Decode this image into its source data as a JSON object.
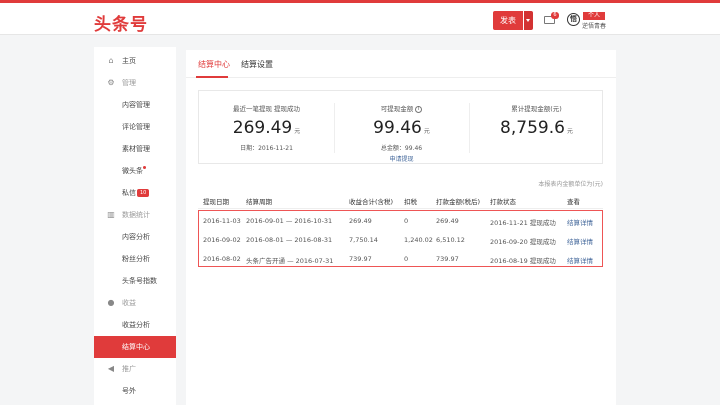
{
  "header": {
    "logo": "头条号",
    "publish_label": "发表",
    "mail_badge": "6",
    "avatar_text": "悟",
    "user_tag": "个人",
    "user_name": "逆悟青春"
  },
  "sidebar": {
    "items": [
      {
        "label": "主页",
        "icon": "home-icon",
        "type": "item"
      },
      {
        "label": "管理",
        "icon": "gear-icon",
        "type": "group"
      },
      {
        "label": "内容管理",
        "type": "sub"
      },
      {
        "label": "评论管理",
        "type": "sub"
      },
      {
        "label": "素材管理",
        "type": "sub"
      },
      {
        "label": "微头条",
        "type": "sub"
      },
      {
        "label": "私信",
        "type": "sub",
        "badge": "10"
      },
      {
        "label": "数据统计",
        "icon": "bar-chart-icon",
        "type": "group"
      },
      {
        "label": "内容分析",
        "type": "sub"
      },
      {
        "label": "粉丝分析",
        "type": "sub"
      },
      {
        "label": "头条号指数",
        "type": "sub"
      },
      {
        "label": "收益",
        "icon": "coin-icon",
        "type": "group"
      },
      {
        "label": "收益分析",
        "type": "sub"
      },
      {
        "label": "结算中心",
        "type": "sub",
        "active": true
      },
      {
        "label": "推广",
        "icon": "megaphone-icon",
        "type": "group"
      },
      {
        "label": "号外",
        "type": "sub"
      }
    ]
  },
  "tabs": [
    {
      "label": "结算中心",
      "active": true
    },
    {
      "label": "结算设置",
      "active": false
    }
  ],
  "summary": {
    "last": {
      "label": "最近一笔提现 提现成功",
      "amount": "269.49",
      "unit": "元",
      "date": "日期：2016-11-21"
    },
    "available": {
      "label": "可提现金额",
      "amount": "99.46",
      "unit": "元",
      "total": "总金额：99.46",
      "action": "申请提现"
    },
    "cumulative": {
      "label": "累计提现金额(元)",
      "amount": "8,759.6",
      "unit": "元"
    }
  },
  "note": "本报表内金额单位为(元)",
  "table": {
    "headers": [
      "提现日期",
      "结算周期",
      "收益合计(含税)",
      "扣税",
      "打款金额(税后)",
      "打款状态",
      "查看"
    ],
    "rows": [
      [
        "2016-11-03",
        "2016-09-01 — 2016-10-31",
        "269.49",
        "0",
        "269.49",
        "2016-11-21 提现成功",
        "结算详情"
      ],
      [
        "2016-09-02",
        "2016-08-01 — 2016-08-31",
        "7,750.14",
        "1,240.02",
        "6,510.12",
        "2016-09-20 提现成功",
        "结算详情"
      ],
      [
        "2016-08-02",
        "头条广告开通 — 2016-07-31",
        "739.97",
        "0",
        "739.97",
        "2016-08-19 提现成功",
        "结算详情"
      ]
    ]
  },
  "colors": {
    "accent": "#e03b3b",
    "link": "#406599"
  }
}
